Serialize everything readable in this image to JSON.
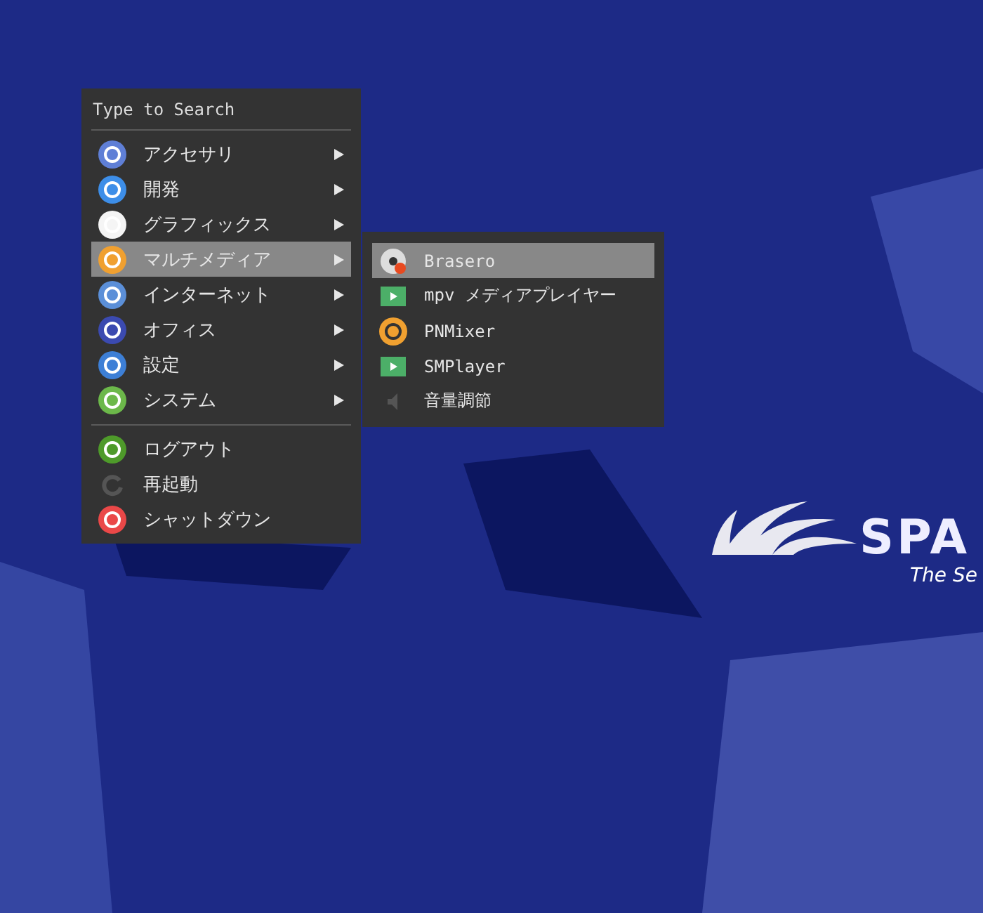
{
  "wallpaper": {
    "logo_text": "SPA",
    "tagline": "The Se"
  },
  "menu": {
    "search": {
      "placeholder": "Type to Search"
    },
    "sections": [
      {
        "items": [
          {
            "label": "アクセサリ",
            "submenu": true,
            "selected": false
          },
          {
            "label": "開発",
            "submenu": true,
            "selected": false
          },
          {
            "label": "グラフィックス",
            "submenu": true,
            "selected": false
          },
          {
            "label": "マルチメディア",
            "submenu": true,
            "selected": true
          },
          {
            "label": "インターネット",
            "submenu": true,
            "selected": false
          },
          {
            "label": "オフィス",
            "submenu": true,
            "selected": false
          },
          {
            "label": "設定",
            "submenu": true,
            "selected": false
          },
          {
            "label": "システム",
            "submenu": true,
            "selected": false
          }
        ]
      },
      {
        "items": [
          {
            "label": "ログアウト",
            "submenu": false,
            "selected": false
          },
          {
            "label": "再起動",
            "submenu": false,
            "selected": false
          },
          {
            "label": "シャットダウン",
            "submenu": false,
            "selected": false
          }
        ]
      }
    ]
  },
  "submenu": {
    "items": [
      {
        "label": "Brasero",
        "selected": true
      },
      {
        "label": "mpv メディアプレイヤー",
        "selected": false
      },
      {
        "label": "PNMixer",
        "selected": false
      },
      {
        "label": "SMPlayer",
        "selected": false
      },
      {
        "label": "音量調節",
        "selected": false
      }
    ]
  }
}
